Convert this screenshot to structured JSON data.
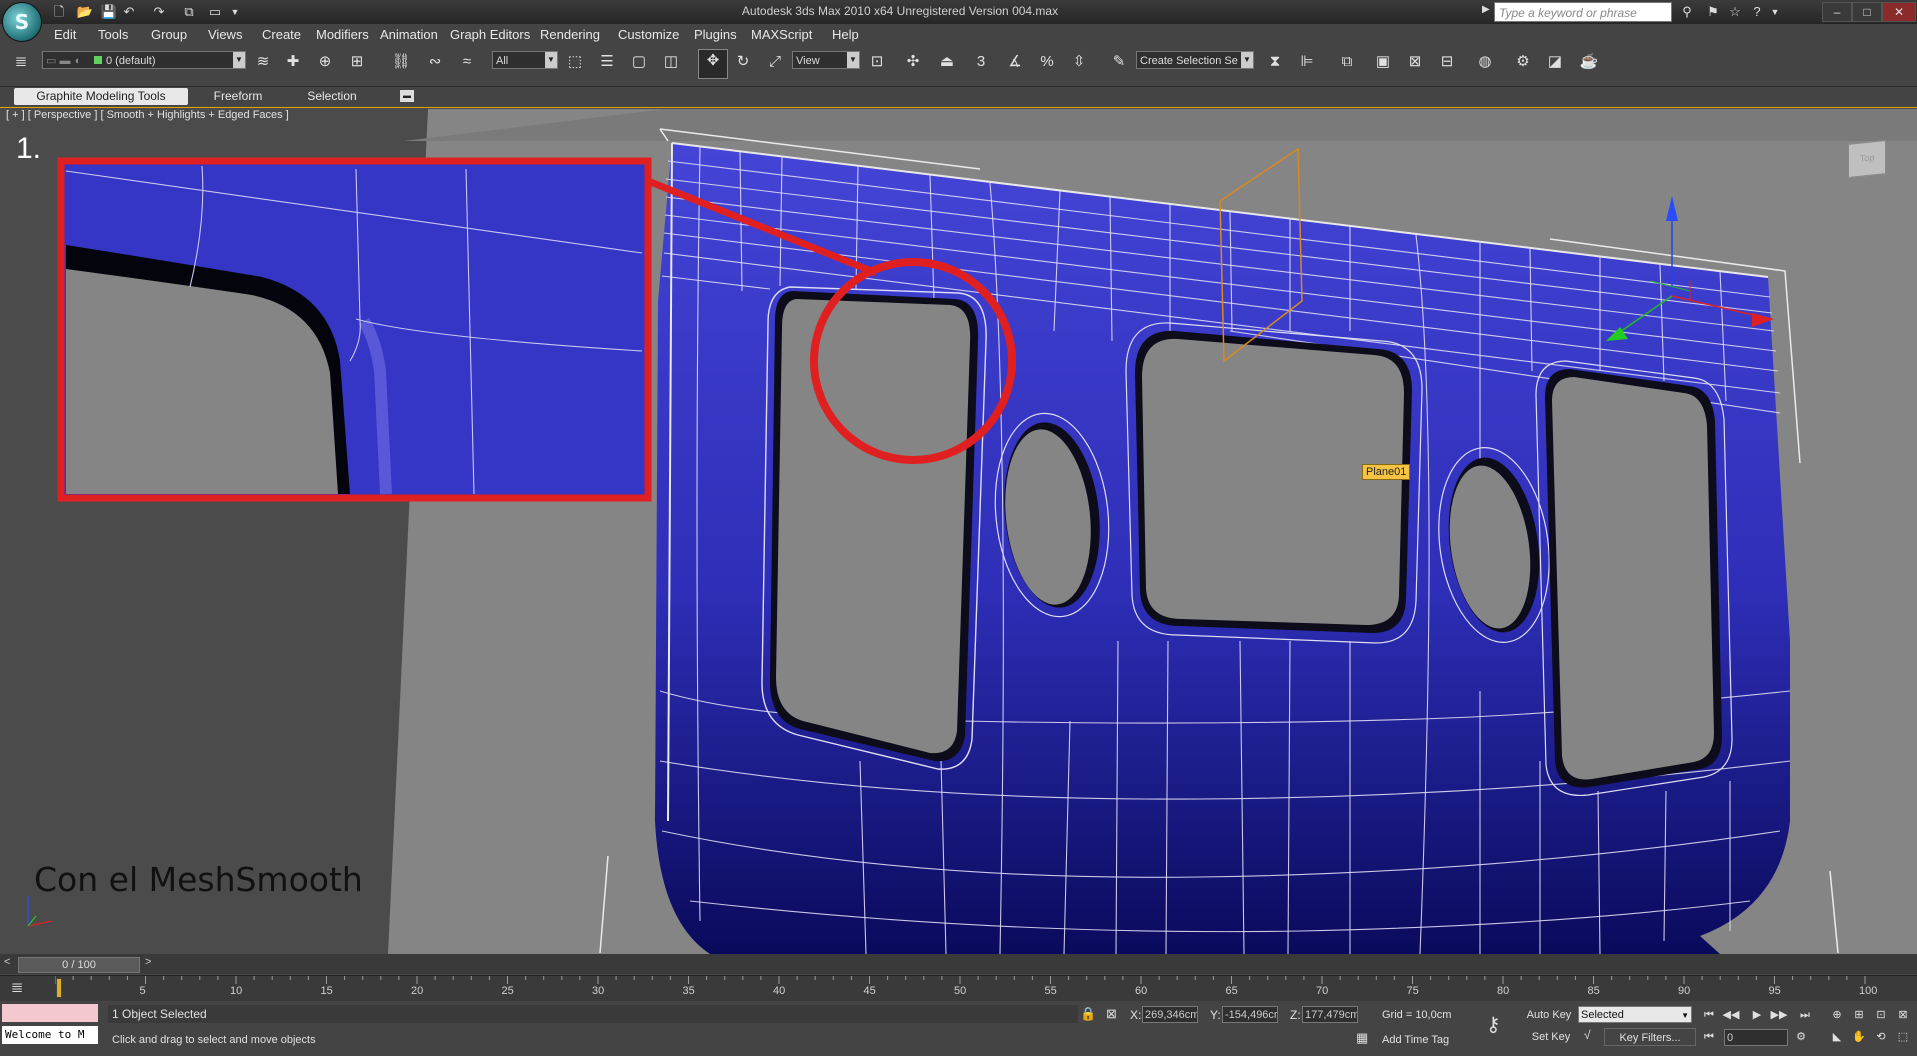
{
  "window": {
    "title": "Autodesk 3ds Max  2010 x64    Unregistered Version     004.max",
    "search_placeholder": "Type a keyword or phrase",
    "controls": [
      "–",
      "□",
      "✕"
    ]
  },
  "menu": [
    "Edit",
    "Tools",
    "Group",
    "Views",
    "Create",
    "Modifiers",
    "Animation",
    "Graph Editors",
    "Rendering",
    "Customize",
    "Plugins",
    "MAXScript",
    "Help"
  ],
  "toolbar": {
    "layer_combo": "0 (default)",
    "filter_combo": "All",
    "coord_combo": "View",
    "selection_set_combo": "Create Selection Se",
    "snap_label": "3"
  },
  "ribbon_tabs": [
    "Graphite Modeling Tools",
    "Freeform",
    "Selection"
  ],
  "viewport": {
    "label": "[ + ] [ Perspective ] [ Smooth + Highlights + Edged Faces ]",
    "step_number": "1.",
    "caption": "Con el MeshSmooth",
    "object_tag": "Plane01",
    "viewcube_label": "Top",
    "mesh_color": "#3838c8",
    "highlight_color": "#e02020"
  },
  "timeline": {
    "thumb": "0 / 100",
    "ticks": [
      "5",
      "10",
      "15",
      "20",
      "25",
      "30",
      "35",
      "40",
      "45",
      "50",
      "55",
      "60",
      "65",
      "70",
      "75",
      "80",
      "85",
      "90",
      "95",
      "100"
    ]
  },
  "status": {
    "listener_text": "Welcome to M",
    "selected": "1 Object Selected",
    "prompt": "Click and drag to select and move objects",
    "x_label": "X:",
    "x_value": "269,346cm",
    "y_label": "Y:",
    "y_value": "-154,496cr",
    "z_label": "Z:",
    "z_value": "177,479cm",
    "grid": "Grid = 10,0cm",
    "add_time_tag": "Add Time Tag",
    "auto_key": "Auto Key",
    "set_key": "Set Key",
    "key_mode": "Selected",
    "key_filters": "Key Filters...",
    "frame": "0"
  }
}
